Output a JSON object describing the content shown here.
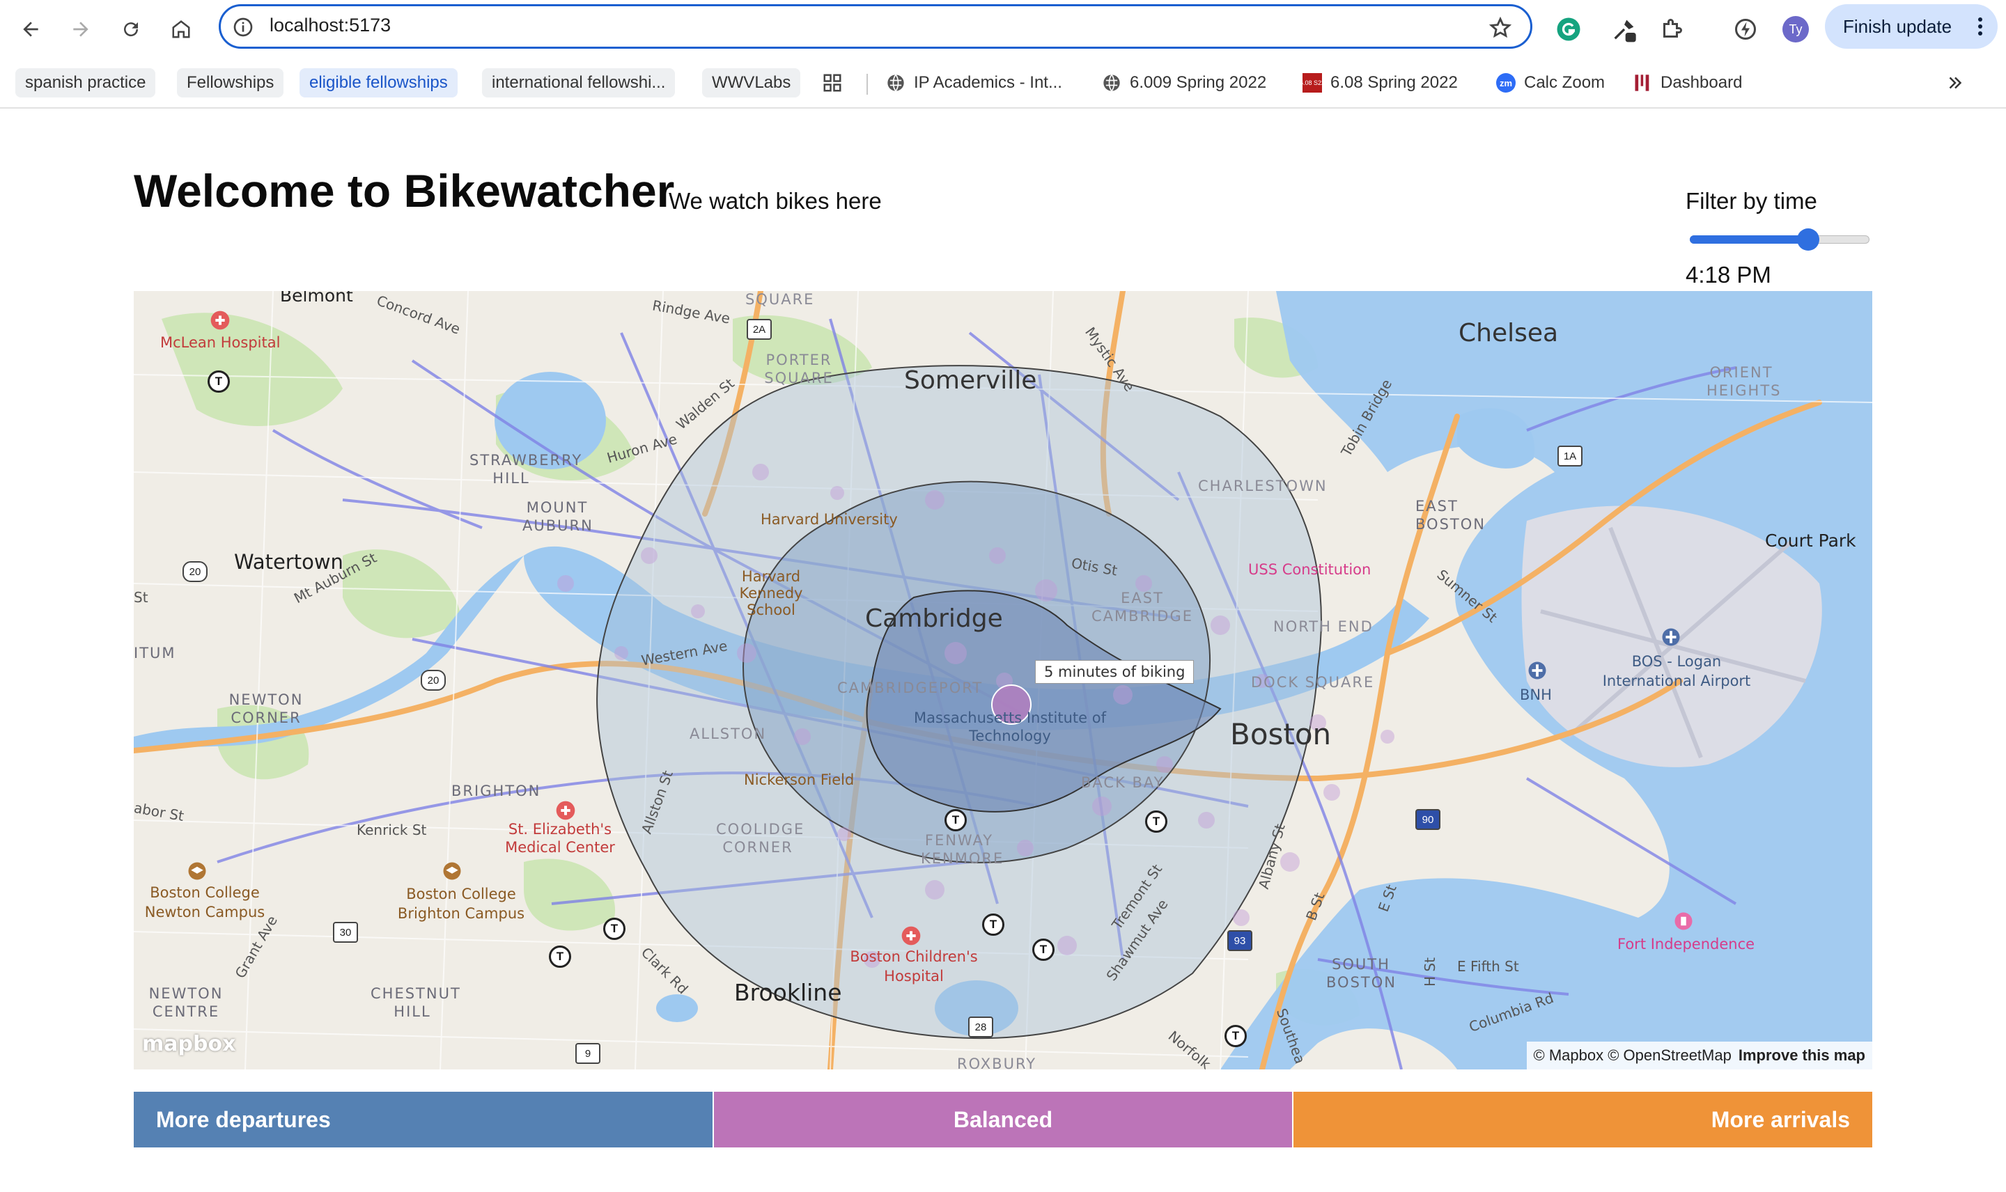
{
  "browser": {
    "url": "localhost:5173",
    "finish_update_label": "Finish update",
    "profile_initials": "Ty",
    "bookmarks": [
      "spanish practice",
      "Fellowships",
      "eligible fellowships",
      "international fellowshi...",
      "WWVLabs",
      "IP Academics - Int...",
      "6.009 Spring 2022",
      "6.08 Spring 2022",
      "Calc Zoom",
      "Dashboard"
    ],
    "bookmark_icons": [
      "apps-grid-icon",
      "globe-icon",
      "globe-icon",
      "6.08-logo-icon",
      "zoom-icon",
      "dashboard-icon"
    ],
    "bookmark_favicon_text": {
      "sixoeight": "6.08 S22",
      "zoom": "zm"
    }
  },
  "page": {
    "title": "Welcome to Bikewatcher",
    "tagline": "We watch bikes here",
    "filter_label": "Filter by time",
    "time_value": "4:18 PM",
    "slider_fraction": 0.66
  },
  "map": {
    "tooltip": "5 minutes of biking",
    "attribution": "© Mapbox © OpenStreetMap",
    "improve_link": "Improve this map",
    "logo": "mapbox",
    "labels": {
      "cities": [
        "Somerville",
        "Chelsea",
        "Cambridge",
        "Boston",
        "Watertown",
        "Brookline"
      ],
      "neighborhoods": [
        "CHARLESTOWN",
        "EAST BOSTON",
        "NORTH END",
        "EAST CAMBRIDGE",
        "CAMBRIDGEPORT",
        "BACK BAY",
        "ALLSTON",
        "BRIGHTON",
        "NEWTON CORNER",
        "STRAWBERRY HILL",
        "MOUNT AUBURN",
        "PORTER SQUARE",
        "COOLIDGE CORNER",
        "FENWAY KENMORE",
        "SOUTH BOSTON",
        "CHESTNUT HILL",
        "NEWTON CENTRE",
        "ORIENT HEIGHTS",
        "DOCK SQUARE",
        "ROXBURY",
        "SQUARE",
        "ITUM"
      ],
      "places": [
        "McLean Hospital",
        "Harvard University",
        "Harvard Kennedy School",
        "Massachusetts Institute of Technology",
        "Nickerson Field",
        "St. Elizabeth's Medical Center",
        "Boston College Newton Campus",
        "Boston College Brighton Campus",
        "Boston Children's Hospital",
        "USS Constitution",
        "BOS - Logan International Airport",
        "BNH",
        "Fort Independence",
        "Court Park",
        "Belmont"
      ],
      "streets": [
        "Concord Ave",
        "Rindge Ave",
        "Walden St",
        "Huron Ave",
        "Mystic Ave",
        "Tobin Bridge",
        "Otis St",
        "Western Ave",
        "Mt Auburn St",
        "Sumner St",
        "Kenrick St",
        "Allston St",
        "Clark Rd",
        "Grant Ave",
        "Tremont St",
        "Shawmut Ave",
        "Albany St",
        "B St",
        "E St",
        "E Fifth St",
        "H St",
        "Columbia Rd",
        "Norfolk",
        "Southea",
        "St",
        "abor St"
      ],
      "shields": [
        "2A",
        "1A",
        "20",
        "20",
        "30",
        "9",
        "28",
        "90",
        "93"
      ]
    }
  },
  "legend": [
    {
      "label": "More departures",
      "color": "#5581b3"
    },
    {
      "label": "Balanced",
      "color": "#bc74b8"
    },
    {
      "label": "More arrivals",
      "color": "#ef9338"
    }
  ]
}
